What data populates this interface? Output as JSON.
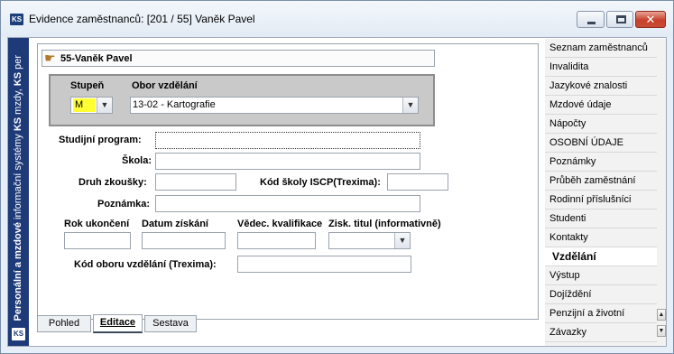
{
  "window": {
    "title": "Evidence zaměstnanců: [201 / 55] Vaněk Pavel",
    "app_icon": "ks-logo-icon",
    "close_glyph": "✕"
  },
  "stripe": {
    "text_pre": "Personální a mzdové ",
    "text_mid": "informační systémy ",
    "text_ks1": "KS",
    "text_mid2": " mzdy, ",
    "text_ks2": "KS",
    "text_post": " per",
    "logo": "KS"
  },
  "employee": {
    "header": "55-Vaněk Pavel"
  },
  "education_group": {
    "stupen_label": "Stupeň",
    "stupen_value": "M",
    "obor_label": "Obor vzdělání",
    "obor_value": "13-02 - Kartografie"
  },
  "form": {
    "studijni_program_label": "Studijní program:",
    "studijni_program_value": "",
    "skola_label": "Škola:",
    "skola_value": "",
    "druh_zkousky_label": "Druh zkoušky:",
    "druh_zkousky_value": "",
    "kod_skoly_label": "Kód školy ISCP(Trexima):",
    "kod_skoly_value": "",
    "poznamka_label": "Poznámka:",
    "poznamka_value": "",
    "rok_ukonceni_label": "Rok ukončení",
    "rok_ukonceni_value": "",
    "datum_ziskani_label": "Datum získání",
    "datum_ziskani_value": "",
    "vedec_kvalifikace_label": "Vědec. kvalifikace",
    "vedec_kvalifikace_value": "",
    "zisk_titul_label": "Zisk. titul (informativně)",
    "zisk_titul_value": "",
    "kod_oboru_label": "Kód oboru vzdělání (Trexima):",
    "kod_oboru_value": ""
  },
  "bottom_tabs": [
    "Pohled",
    "Editace",
    "Sestava"
  ],
  "sidebar": {
    "items": [
      "Seznam zaměstnanců",
      "Invalidita",
      "Jazykové znalosti",
      "Mzdové údaje",
      "Nápočty",
      "OSOBNÍ ÚDAJE",
      "Poznámky",
      "Průběh zaměstnání",
      "Rodinní příslušníci",
      "Studenti",
      "Kontakty",
      "Vzdělání",
      "Výstup",
      "Dojíždění",
      "Penzijní a životní",
      "Závazky"
    ],
    "active": "Vzdělání"
  },
  "colors": {
    "stupen_highlight": "#ffff33",
    "stripe": "#1f3a78",
    "groupbox": "#c9c9c9"
  }
}
